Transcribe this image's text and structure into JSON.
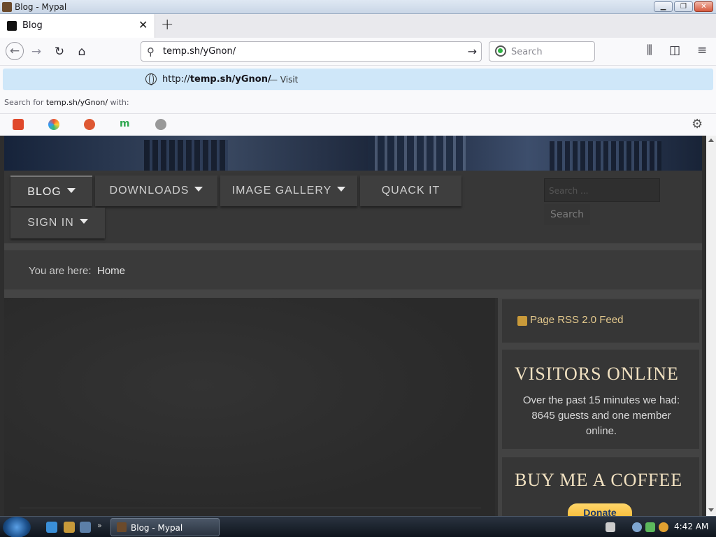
{
  "window": {
    "title": "Blog - Mypal"
  },
  "tabs": [
    {
      "label": "Blog"
    }
  ],
  "toolbar": {
    "url_value": "temp.sh/yGnon/",
    "search_placeholder": "Search"
  },
  "url_dropdown": {
    "suggestion_prefix": "http://",
    "suggestion_host": "temp.sh/yGnon/",
    "suggestion_action": "— Visit",
    "search_for_prefix": "Search for ",
    "search_for_term": "temp.sh/yGnon/",
    "search_for_suffix": " with:"
  },
  "site": {
    "menu": [
      {
        "label": "BLOG",
        "has_dropdown": true,
        "active": true
      },
      {
        "label": "DOWNLOADS",
        "has_dropdown": true
      },
      {
        "label": "IMAGE GALLERY",
        "has_dropdown": true
      },
      {
        "label": "QUACK IT",
        "has_dropdown": false
      },
      {
        "label": "SIGN IN",
        "has_dropdown": true
      }
    ],
    "search_placeholder": "Search ...",
    "search_button": "Search",
    "breadcrumb_label": "You are here:",
    "breadcrumb_home": "Home",
    "rss_link": "Page RSS 2.0 Feed",
    "visitors_title": "VISITORS ONLINE",
    "visitors_text": "Over the past 15 minutes we had: 8645 guests and one member online.",
    "coffee_title": "BUY ME A COFFEE",
    "donate_label": "Donate"
  },
  "taskbar": {
    "task_label": "Blog - Mypal",
    "clock": "4:42 AM"
  },
  "colors": {
    "accent_text": "#f1e1c1",
    "rss": "#e4c98d",
    "donate": "#f5b52e"
  }
}
